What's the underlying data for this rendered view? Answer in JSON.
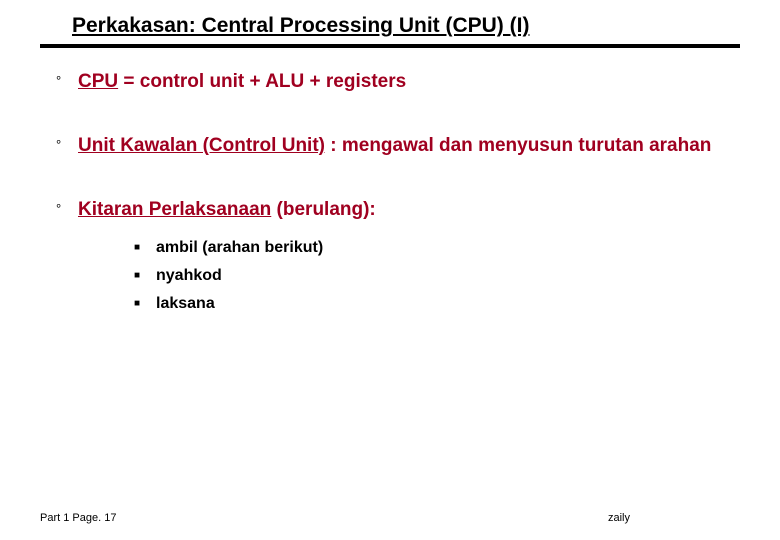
{
  "title": "Perkakasan: Central Processing Unit (CPU) (I)",
  "bullets": {
    "b1": {
      "ul": "CPU",
      "rest": " = control unit + ALU + registers"
    },
    "b2": {
      "ul": "Unit Kawalan (Control Unit)",
      "rest": " : mengawal dan menyusun turutan arahan"
    },
    "b3": {
      "ul": "Kitaran Perlaksanaan",
      "rest": " (berulang):"
    }
  },
  "subs": {
    "s1": "ambil (arahan berikut)",
    "s2": "nyahkod",
    "s3": "laksana"
  },
  "footer": {
    "left": "Part 1 Page. 17",
    "right": "zaily"
  },
  "marks": {
    "deg": "°",
    "sq": "■"
  }
}
